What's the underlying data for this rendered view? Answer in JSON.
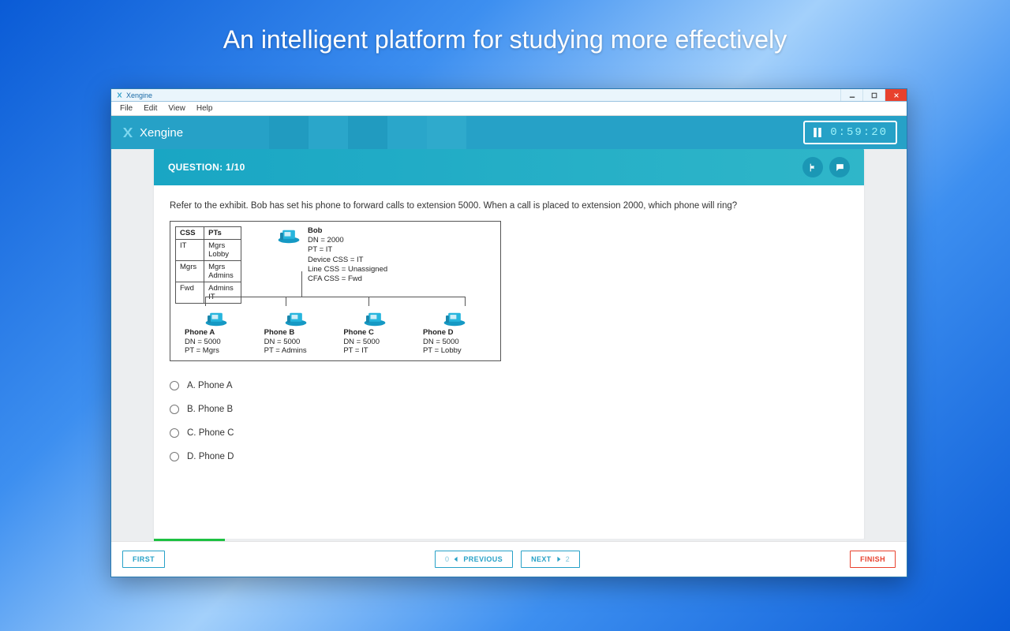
{
  "tagline": "An intelligent platform for studying more effectively",
  "window": {
    "title": "Xengine"
  },
  "menu": {
    "file": "File",
    "edit": "Edit",
    "view": "View",
    "help": "Help"
  },
  "brand": "Xengine",
  "timer": "0:59:20",
  "question": {
    "counter_label": "QUESTION: 1/10",
    "current": 1,
    "total": 10,
    "text": "Refer to the exhibit. Bob has set his phone to forward calls to extension 5000. When a call is placed to extension 2000, which phone will ring?"
  },
  "exhibit": {
    "table": {
      "headers": [
        "CSS",
        "PTs"
      ],
      "rows": [
        [
          "IT",
          "Mgrs\nLobby"
        ],
        [
          "Mgrs",
          "Mgrs\nAdmins"
        ],
        [
          "Fwd",
          "Admins\nIT"
        ]
      ]
    },
    "bob": {
      "name": "Bob",
      "lines": [
        "DN = 2000",
        "PT = IT",
        "Device CSS = IT",
        "Line CSS = Unassigned",
        "CFA CSS = Fwd"
      ]
    },
    "phones": [
      {
        "name": "Phone A",
        "dn": "DN = 5000",
        "pt": "PT = Mgrs"
      },
      {
        "name": "Phone B",
        "dn": "DN = 5000",
        "pt": "PT = Admins"
      },
      {
        "name": "Phone C",
        "dn": "DN = 5000",
        "pt": "PT = IT"
      },
      {
        "name": "Phone D",
        "dn": "DN = 5000",
        "pt": "PT = Lobby"
      }
    ]
  },
  "answers": [
    {
      "key": "A",
      "label": "A. Phone A"
    },
    {
      "key": "B",
      "label": "B. Phone B"
    },
    {
      "key": "C",
      "label": "C. Phone C"
    },
    {
      "key": "D",
      "label": "D. Phone D"
    }
  ],
  "nav": {
    "first": "FIRST",
    "prev_num": "0",
    "prev": "PREVIOUS",
    "next": "NEXT",
    "next_num": "2",
    "finish": "FINISH"
  },
  "progress_pct": 10
}
